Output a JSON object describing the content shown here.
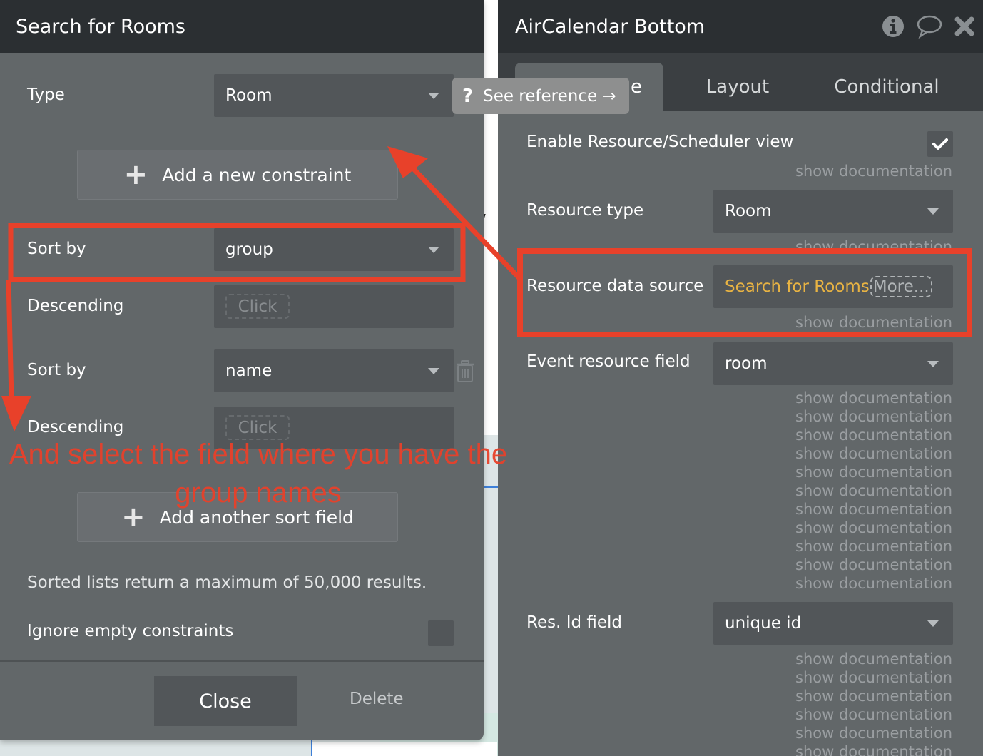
{
  "left_panel": {
    "title": "Search for Rooms",
    "type_label": "Type",
    "type_value": "Room",
    "add_constraint_label": "Add a new constraint",
    "sorts": [
      {
        "sort_label": "Sort by",
        "sort_value": "group",
        "desc_label": "Descending",
        "desc_value": "Click"
      },
      {
        "sort_label": "Sort by",
        "sort_value": "name",
        "desc_label": "Descending",
        "desc_value": "Click"
      }
    ],
    "add_sort_label": "Add another sort field",
    "note": "Sorted lists return a maximum of 50,000 results.",
    "ignore_empty_label": "Ignore empty constraints",
    "ignore_empty_checked": false,
    "close_label": "Close",
    "delete_label": "Delete"
  },
  "tooltip": {
    "icon": "question-icon",
    "label": "See reference →"
  },
  "right_panel": {
    "title": "AirCalendar Bottom",
    "icons": [
      "info-icon",
      "comment-icon",
      "close-icon"
    ],
    "tabs": [
      {
        "label": "Appearance",
        "active": true
      },
      {
        "label": "Layout",
        "active": false
      },
      {
        "label": "Conditional",
        "active": false
      }
    ],
    "visible_tab_fragment": "e",
    "enable_resource_label": "Enable Resource/Scheduler view",
    "enable_resource_checked": true,
    "resource_type_label": "Resource type",
    "resource_type_value": "Room",
    "resource_source_label": "Resource data source",
    "resource_source_value": "Search for Rooms",
    "resource_source_more": "More...",
    "event_resource_label": "Event resource field",
    "event_resource_value": "room",
    "res_id_label": "Res. Id field",
    "res_id_value": "unique id",
    "doc_link": "show documentation"
  },
  "annotation": {
    "text": "And select the field where you have the group names",
    "color": "#e8412a"
  },
  "colors": {
    "panel_bg": "#626769",
    "header_bg": "#2b2f32",
    "input_bg": "#525659",
    "dynamic_value": "#e8b343",
    "annotation_red": "#e8412a"
  }
}
